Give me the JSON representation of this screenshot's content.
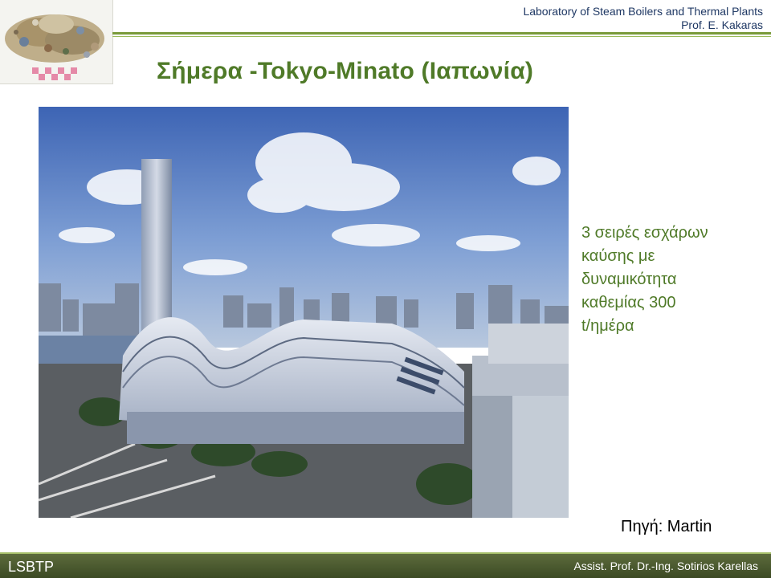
{
  "header": {
    "lab_name": "Laboratory of Steam Boilers and Thermal Plants",
    "professor": "Prof. E. Kakaras"
  },
  "slide": {
    "title": "Σήμερα -Tokyo-Minato (Ιαπωνία)",
    "description_lines": [
      "3 σειρές εσχάρων",
      "καύσης με",
      "δυναμικότητα",
      "καθεμίας 300",
      "t/ημέρα"
    ],
    "source": "Πηγή: Martin"
  },
  "footer": {
    "left": "LSBTP",
    "right": "Assist. Prof. Dr.-Ing. Sotirios Karellas"
  }
}
